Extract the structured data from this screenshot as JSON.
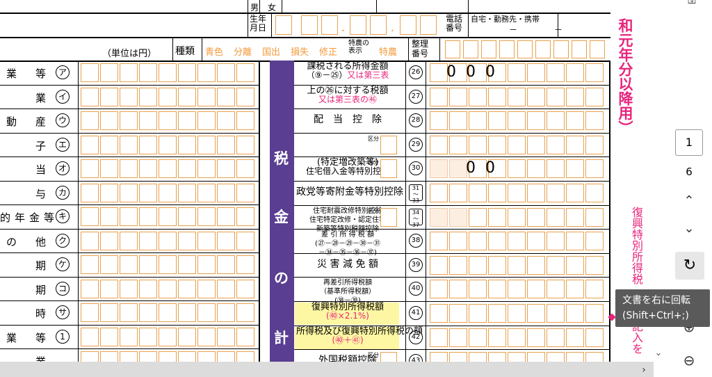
{
  "form": {
    "header": {
      "sex_male": "男",
      "sex_female": "女",
      "birth_label_1": "生年",
      "birth_label_2": "月日",
      "phone_label_1": "電話",
      "phone_label_2": "番号",
      "phone_types": "自宅・勤務先・携帯",
      "phone_dash": "－",
      "unit_label": "（単位は円）",
      "kind_label": "種類",
      "kind_items": [
        "青色",
        "分離",
        "国出",
        "損失",
        "修正"
      ],
      "special_label_1": "特農の",
      "special_label_2": "表示",
      "special_item": "特農",
      "ref_label_1": "整理",
      "ref_label_2": "番号",
      "dot": "．"
    },
    "left_rows": [
      {
        "text": "業　等",
        "mark": "ア"
      },
      {
        "text": "業",
        "mark": "イ"
      },
      {
        "text": "動　産",
        "mark": "ウ"
      },
      {
        "text": "子",
        "mark": "エ"
      },
      {
        "text": "当",
        "mark": "オ"
      },
      {
        "text": "与",
        "mark": "カ"
      },
      {
        "text": "的年金等",
        "mark": "キ"
      },
      {
        "text": "の　他",
        "mark": "ク"
      },
      {
        "text": "期",
        "mark": "ケ"
      },
      {
        "text": "期",
        "mark": "コ"
      },
      {
        "text": "時",
        "mark": "サ"
      },
      {
        "text": "業　等",
        "mark": "1"
      },
      {
        "text": "業",
        "mark": ""
      }
    ],
    "tax_section": {
      "vertical_title": [
        "税",
        "金",
        "の",
        "計"
      ],
      "rows": [
        {
          "label_1": "課税される所得金額",
          "label_2a": "（⑨－㉕）",
          "label_2b": "又は第三表",
          "num": "26",
          "value": "000"
        },
        {
          "label_1": "上の㉖に対する税額",
          "label_2": "又は第三表の㊻",
          "num": "27",
          "value": ""
        },
        {
          "label_1": "配　当　控　除",
          "num": "28",
          "value": ""
        },
        {
          "label_1": "",
          "kubun": "区分",
          "num": "29",
          "value": ""
        },
        {
          "label_1": "(特定増改築等)",
          "label_2": "住宅借入金等特別控除",
          "kubun": "区分",
          "num": "30",
          "value": "00"
        },
        {
          "label_1": "政党等寄附金等特別控除",
          "num": "31～33",
          "value": ""
        },
        {
          "label_1": "住宅耐震改修特別控除",
          "label_2": "住宅特定改修・認定住宅",
          "label_3": "新築等特別税額控除",
          "kubun": "区分",
          "num": "34～37",
          "value": ""
        },
        {
          "label_1": "差 引 所 得 税 額",
          "label_2": "(㉗－㉘－㉙－㉚－㉛",
          "label_3": "－㉞－㉟－㊱－㊲)",
          "num": "38",
          "value": ""
        },
        {
          "label_1": "災 害 減 免 額",
          "num": "39",
          "value": ""
        },
        {
          "label_1": "再差引所得税額",
          "label_2": "（基準所得税額）",
          "label_3": "(㊳－㊴)",
          "num": "40",
          "value": ""
        },
        {
          "label_1": "復興特別所得税額",
          "label_2": "(㊵×2.1%)",
          "num": "41",
          "value": ""
        },
        {
          "label_1": "所得税及び復興特別所得税の額",
          "label_2": "(㊵＋㊶)",
          "num": "42",
          "value": ""
        },
        {
          "label_1": "外国税額控除",
          "kubun": "区分",
          "num": "43",
          "value": ""
        }
      ]
    },
    "right_margin_top": "和元年分以降用）",
    "right_margin_bottom": "復興特別所得税",
    "right_margin_bottom2": "記入を"
  },
  "viewer": {
    "current_page": "1",
    "total_pages": "6",
    "tooltip_line1": "文書を右に回転",
    "tooltip_line2": "(Shift+Ctrl+;)"
  }
}
